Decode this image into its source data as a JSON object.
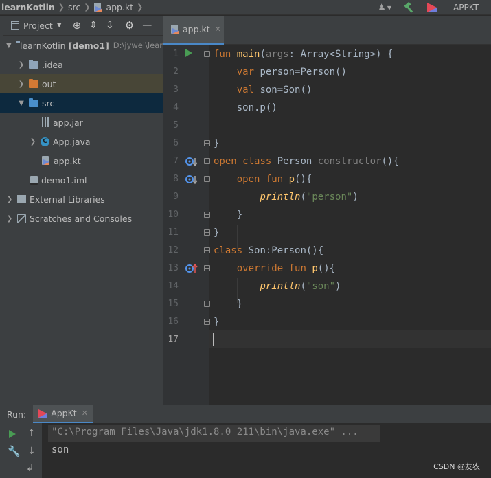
{
  "navbar": {
    "project": "learnKotlin",
    "folder": "src",
    "file": "app.kt",
    "run_config": "APPKT",
    "colors": {
      "build_hammer": "#59a869",
      "kotlin_logo": "#e44857"
    }
  },
  "project_panel": {
    "title": "Project",
    "tree": [
      {
        "label": "learnKotlin",
        "module": "[demo1]",
        "path": "D:\\jywei\\lear",
        "icon": "module-folder-icon",
        "expanded": true
      },
      {
        "label": ".idea",
        "icon": "folder-icon",
        "expanded": false
      },
      {
        "label": "out",
        "icon": "excluded-folder-icon",
        "expanded": false
      },
      {
        "label": "src",
        "icon": "source-folder-icon",
        "expanded": true,
        "selected": true
      },
      {
        "label": "app.jar",
        "icon": "jar-icon"
      },
      {
        "label": "App.java",
        "icon": "java-class-icon",
        "expanded": false
      },
      {
        "label": "app.kt",
        "icon": "kotlin-file-icon"
      },
      {
        "label": "demo1.iml",
        "icon": "iml-file-icon"
      },
      {
        "label": "External Libraries",
        "icon": "libraries-icon",
        "expanded": false
      },
      {
        "label": "Scratches and Consoles",
        "icon": "scratches-icon",
        "expanded": false
      }
    ]
  },
  "editor": {
    "tab_label": "app.kt",
    "line_numbers": [
      "1",
      "2",
      "3",
      "4",
      "5",
      "6",
      "7",
      "8",
      "9",
      "10",
      "11",
      "12",
      "13",
      "14",
      "15",
      "16",
      "17"
    ],
    "lines": [
      "fun main(args: Array<String>) {",
      "    var person=Person()",
      "    val son=Son()",
      "    son.p()",
      "",
      "}",
      "open class Person constructor(){",
      "    open fun p(){",
      "        println(\"person\")",
      "    }",
      "}",
      "class Son:Person(){",
      "    override fun p(){",
      "        println(\"son\")",
      "    }",
      "}",
      ""
    ],
    "current_line": 17
  },
  "run_panel": {
    "label": "Run:",
    "tab_label": "AppKt",
    "command": "\"C:\\Program Files\\Java\\jdk1.8.0_211\\bin\\java.exe\" ...",
    "output": "son"
  },
  "watermark": "CSDN @友农"
}
